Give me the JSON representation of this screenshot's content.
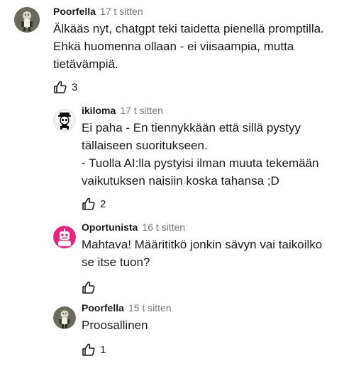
{
  "comments": [
    {
      "author": "Poorfella",
      "time": "17 t sitten",
      "lines": [
        "Älkääs nyt, chatgpt teki taidetta pienellä promptilla.",
        "Ehkä huomenna ollaan - ei viisaampia, mutta",
        "tietävämpiä."
      ],
      "likes": "3"
    },
    {
      "author": "ikiloma",
      "time": "17 t sitten",
      "lines": [
        "Ei paha - En tiennykkään että sillä pystyy",
        "tällaiseen suoritukseen.",
        "- Tuolla AI:lla pystyisi ilman muuta tekemään",
        "vaikutuksen naisiin koska tahansa ;D"
      ],
      "likes": "2"
    },
    {
      "author": "Oportunista",
      "time": "16 t sitten",
      "lines": [
        "Mahtava! Määrititkö jonkin sävyn vai taikoilko",
        "se itse tuon?"
      ],
      "likes": ""
    },
    {
      "author": "Poorfella",
      "time": "15 t sitten",
      "lines": [
        "Proosallinen"
      ],
      "likes": "1"
    }
  ],
  "icons": {
    "like": "thumbs-up-icon",
    "avatar_poorfella": "character-avatar",
    "avatar_ikiloma": "skull-avatar",
    "avatar_oportunista": "pink-robot-avatar"
  },
  "colors": {
    "text": "#1a1a1a",
    "meta": "#757575",
    "oportunista_avatar": "#e8227f"
  }
}
